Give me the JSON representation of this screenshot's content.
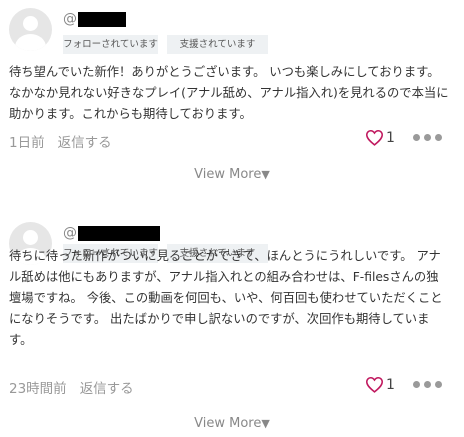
{
  "comments": [
    {
      "username_prefix": "@",
      "badges": [
        "フォローされています",
        "支援されています"
      ],
      "text": "待ち望んでいた新作！ありがとうございます。 いつも楽しみにしております。 なかなか見れない好きなプレイ(アナル舐め、アナル指入れ)を見れるので本当に助かります。これからも期待しております。",
      "time": "1日前",
      "reply_label": "返信する",
      "likes": "1",
      "view_more": "View More",
      "view_more_arrow": "▼"
    },
    {
      "username_prefix": "@",
      "badges": [
        "フォローされています",
        "支援されています"
      ],
      "text": "待ちに待った新作がついに見ることができて、ほんとうにうれしいです。 アナル舐めは他にもありますが、アナル指入れとの組み合わせは、F-filesさんの独壇場ですね。 今後、この動画を何回も、いや、何百回も使わせていただくことになりそうです。 出たばかりで申し訳ないのですが、次回作も期待しています。",
      "time": "23時間前",
      "reply_label": "返信する",
      "likes": "1",
      "view_more": "View More",
      "view_more_arrow": "▼"
    }
  ],
  "colors": {
    "heart": "#c0185e",
    "badge_bg": "#eef1f3",
    "muted_text": "#999999"
  },
  "icons": {
    "like": "heart-outline-icon",
    "more": "more-horizontal-icon",
    "avatar": "default-user-avatar"
  }
}
